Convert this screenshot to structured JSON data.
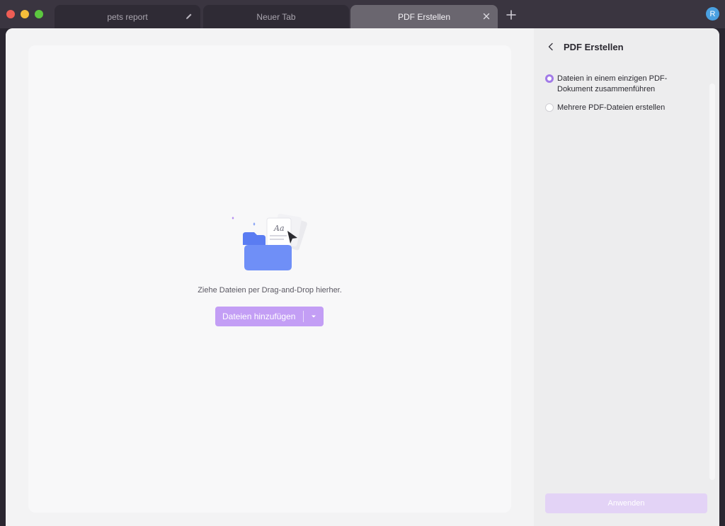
{
  "tabs": [
    {
      "label": "pets report"
    },
    {
      "label": "Neuer Tab"
    },
    {
      "label": "PDF Erstellen"
    }
  ],
  "user": {
    "avatar_initial": "R"
  },
  "drop_zone": {
    "hint": "Ziehe Dateien per Drag-and-Drop hierher.",
    "add_button_label": "Dateien hinzufügen",
    "illustration_text": "Aa"
  },
  "panel": {
    "title": "PDF Erstellen",
    "options": [
      {
        "label_line1": "Dateien in einem einzigen PDF-",
        "label_line2": "Dokument zusammenführen",
        "selected": true
      },
      {
        "label_line1": "Mehrere PDF-Dateien erstellen",
        "selected": false
      }
    ],
    "apply_label": "Anwenden"
  },
  "colors": {
    "accent": "#c39ef5",
    "radio_selected": "#a27be8",
    "apply_disabled": "#e3d3f6",
    "avatar": "#4aa0e0"
  }
}
